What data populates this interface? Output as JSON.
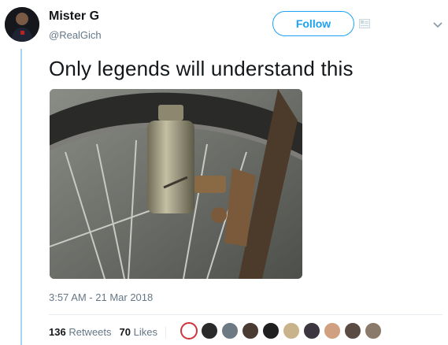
{
  "author": {
    "name": "Mister G",
    "handle": "@RealGich"
  },
  "follow_label": "Follow",
  "tweet_text": "Only legends will understand this",
  "timestamp": "3:57 AM - 21 Mar 2018",
  "stats": {
    "retweets_count": "136",
    "retweets_label": "Retweets",
    "likes_count": "70",
    "likes_label": "Likes"
  },
  "icons": {
    "add_user": "add-user-icon",
    "more": "chevron-down-icon"
  },
  "colors": {
    "accent": "#1da1f2",
    "thread_line": "#a9d3ef",
    "muted": "#657786"
  },
  "likers": [
    {
      "bg": "#ffffff",
      "ring": "#d0343a"
    },
    {
      "bg": "#2a2a2a",
      "ring": "#2a2a2a"
    },
    {
      "bg": "#6d7a83",
      "ring": "#6d7a83"
    },
    {
      "bg": "#4a3b32",
      "ring": "#4a3b32"
    },
    {
      "bg": "#1f1f1f",
      "ring": "#1f1f1f"
    },
    {
      "bg": "#c9b38a",
      "ring": "#c9b38a"
    },
    {
      "bg": "#3b3640",
      "ring": "#3b3640"
    },
    {
      "bg": "#d0a080",
      "ring": "#d0a080"
    },
    {
      "bg": "#5a4c42",
      "ring": "#5a4c42"
    },
    {
      "bg": "#8a7a6a",
      "ring": "#8a7a6a"
    }
  ]
}
